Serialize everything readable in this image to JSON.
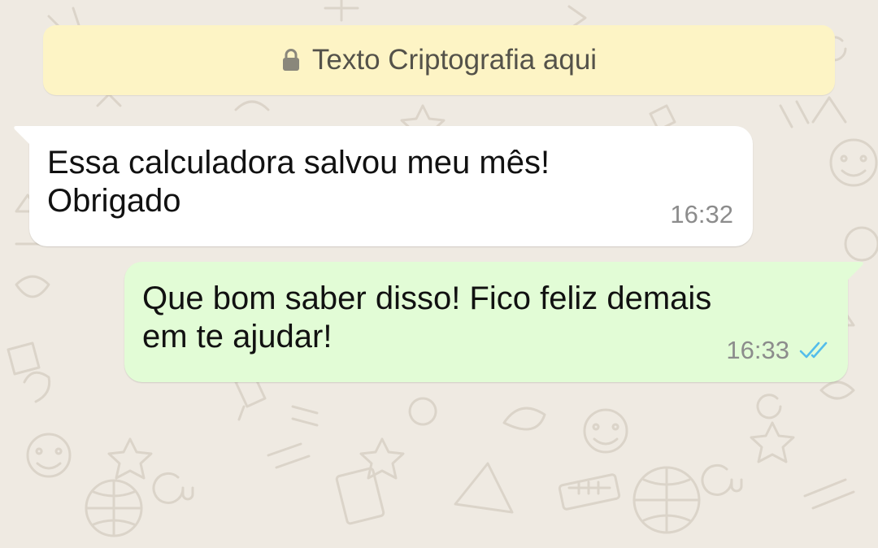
{
  "banner": {
    "icon": "lock-icon",
    "text": "Texto Criptografia aqui"
  },
  "messages": [
    {
      "direction": "incoming",
      "text": "Essa calculadora salvou meu mês!\nObrigado",
      "time": "16:32"
    },
    {
      "direction": "outgoing",
      "text": "Que bom saber disso! Fico feliz demais\nem te ajudar!",
      "time": "16:33",
      "status_icon": "double-check-read-icon"
    }
  ],
  "colors": {
    "background": "#efeae2",
    "banner": "#fdf4c5",
    "incoming_bubble": "#ffffff",
    "outgoing_bubble": "#e2fcd6",
    "read_ticks": "#53bdeb",
    "timestamp": "#8c8c8c"
  }
}
